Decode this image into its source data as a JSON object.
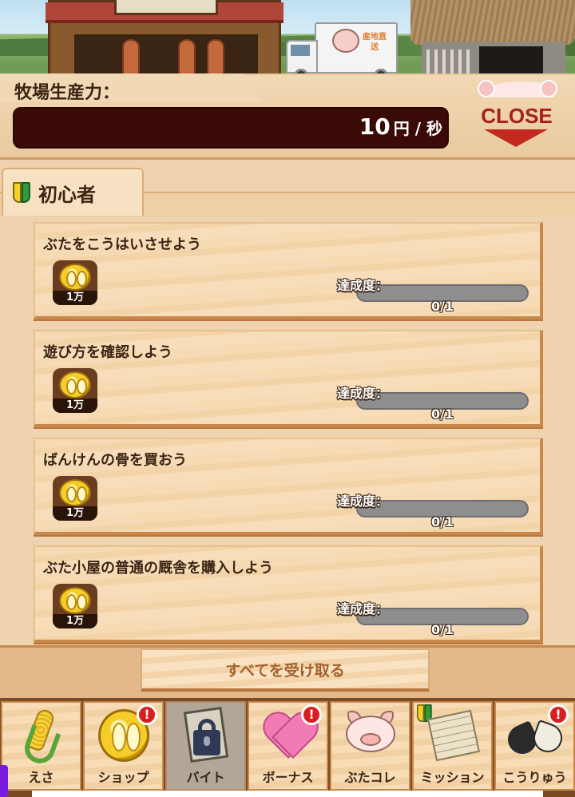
{
  "productivity": {
    "label": "牧場生産力：",
    "value": "10",
    "unit": "円 / 秒"
  },
  "close_button": {
    "label": "CLOSE"
  },
  "truck_text": "産地直送",
  "category": {
    "label": "初心者",
    "icon": "beginner-mark-icon"
  },
  "missions": [
    {
      "title": "ぶたをこうはいさせよう",
      "reward": "1万",
      "progress_label": "達成度：",
      "progress": "0/1",
      "progress_fraction": 0
    },
    {
      "title": "遊び方を確認しよう",
      "reward": "1万",
      "progress_label": "達成度：",
      "progress": "0/1",
      "progress_fraction": 0
    },
    {
      "title": "ばんけんの骨を買おう",
      "reward": "1万",
      "progress_label": "達成度：",
      "progress": "0/1",
      "progress_fraction": 0
    },
    {
      "title": "ぶた小屋の普通の厩舎を購入しよう",
      "reward": "1万",
      "progress_label": "達成度：",
      "progress": "0/1",
      "progress_fraction": 0
    }
  ],
  "receive_all": {
    "label": "すべてを受け取る"
  },
  "nav": [
    {
      "label": "えさ",
      "icon": "corn-icon",
      "badge": "",
      "locked": false
    },
    {
      "label": "ショップ",
      "icon": "coin-icon",
      "badge": "!",
      "locked": false
    },
    {
      "label": "バイト",
      "icon": "lock-icon",
      "badge": "",
      "locked": true
    },
    {
      "label": "ボーナス",
      "icon": "heart-icon",
      "badge": "!",
      "locked": false
    },
    {
      "label": "ぶたコレ",
      "icon": "pig-icon",
      "badge": "",
      "locked": false
    },
    {
      "label": "ミッション",
      "icon": "scroll-icon",
      "badge": "",
      "locked": false
    },
    {
      "label": "こうりゅう",
      "icon": "gloves-icon",
      "badge": "!",
      "locked": false
    }
  ],
  "colors": {
    "productivity_bar": "#3a0a06",
    "close_label": "#a5201a",
    "badge": "#d81e1e",
    "receive_text": "#a3602c"
  }
}
